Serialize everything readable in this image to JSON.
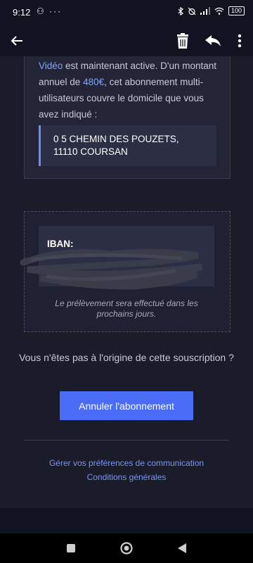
{
  "status_bar": {
    "time": "9:12",
    "left_icons": "⚇ ···",
    "signal": "▂▄▆",
    "wifi": "wifi",
    "battery": "100"
  },
  "app_bar": {
    "back_icon": "arrow-left-icon",
    "delete_icon": "trash-icon",
    "reply_icon": "reply-icon",
    "more_icon": "more-vertical-icon"
  },
  "message": {
    "paragraph_link_start": "Vidéo",
    "paragraph_part1": " est maintenant active. D'un montant annuel de ",
    "amount": "480€",
    "paragraph_part2": ", cet abonnement multi-utilisateurs couvre le domicile que vous avez indiqué :",
    "address_line1": "0 5 CHEMIN DES POUZETS,",
    "address_line2": "11110 COURSAN",
    "iban_label": "IBAN:",
    "iban_note": "Le prélèvement sera effectué dans les prochains jours.",
    "question": "Vous n'êtes pas à l'origine de cette souscription ?",
    "cancel_label": "Annuler l'abonnement",
    "link_preferences": "Gérer vos préférences de communication",
    "link_conditions": "Conditions générales"
  },
  "colors": {
    "accent": "#4a6cf7",
    "link": "#7fa7ff",
    "background": "#1b1c2a"
  }
}
